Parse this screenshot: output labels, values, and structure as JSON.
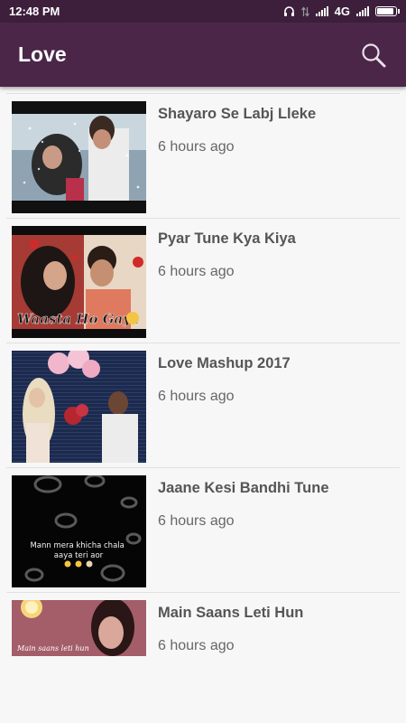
{
  "status_bar": {
    "time": "12:48 PM",
    "network": "4G",
    "icons": [
      "headphones-icon",
      "data-arrows-icon",
      "signal-icon",
      "signal-icon",
      "battery-icon"
    ],
    "battery_level": 0.9
  },
  "app_bar": {
    "title": "Love",
    "search_icon": "search-icon"
  },
  "videos": [
    {
      "title": "Shayaro Se Labj Lleke",
      "time": "6 hours ago"
    },
    {
      "title": "Pyar Tune Kya Kiya",
      "time": "6 hours ago",
      "thumb_caption": "Waasta Ho Gaya"
    },
    {
      "title": "Love Mashup 2017",
      "time": "6 hours ago"
    },
    {
      "title": "Jaane Kesi Bandhi Tune",
      "time": "6 hours ago",
      "thumb_caption": "Mann mera khicha chala aaya teri aor"
    },
    {
      "title": "Main Saans Leti Hun",
      "time": "6 hours ago",
      "thumb_caption": "Main saans leti hun"
    }
  ]
}
